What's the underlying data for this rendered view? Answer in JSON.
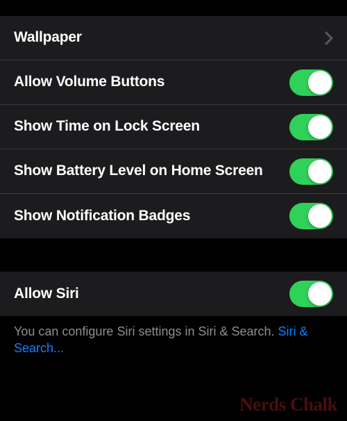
{
  "section1": {
    "items": [
      {
        "label": "Wallpaper",
        "type": "chevron"
      },
      {
        "label": "Allow Volume Buttons",
        "type": "toggle",
        "on": true
      },
      {
        "label": "Show Time on Lock Screen",
        "type": "toggle",
        "on": true
      },
      {
        "label": "Show Battery Level on Home Screen",
        "type": "toggle",
        "on": true
      },
      {
        "label": "Show Notification Badges",
        "type": "toggle",
        "on": true
      }
    ]
  },
  "section2": {
    "items": [
      {
        "label": "Allow Siri",
        "type": "toggle",
        "on": true
      }
    ],
    "footer_text": "You can configure Siri settings in Siri & Search. ",
    "footer_link": "Siri & Search..."
  },
  "watermark": "Nerds Chalk"
}
